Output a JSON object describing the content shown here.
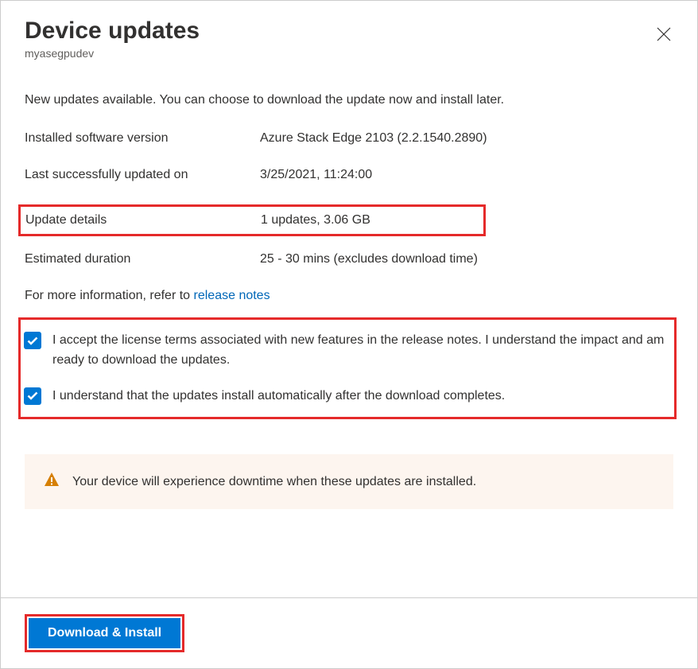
{
  "header": {
    "title": "Device updates",
    "subtitle": "myasegpudev"
  },
  "intro": "New updates available. You can choose to download the update now and install later.",
  "info": {
    "installed_version_label": "Installed software version",
    "installed_version_value": "Azure Stack Edge 2103 (2.2.1540.2890)",
    "last_updated_label": "Last successfully updated on",
    "last_updated_value": "3/25/2021, 11:24:00",
    "update_details_label": "Update details",
    "update_details_value": "1 updates, 3.06 GB",
    "duration_label": "Estimated duration",
    "duration_value": "25 - 30 mins (excludes download time)"
  },
  "more_info": {
    "prefix": "For more information, refer to ",
    "link": "release notes"
  },
  "checkboxes": {
    "accept_license": "I accept the license terms associated with new features in the release notes. I understand the impact and am ready to download the updates.",
    "auto_install": "I understand that the updates install automatically after the download completes."
  },
  "warning": "Your device will experience downtime when these updates are installed.",
  "footer": {
    "download_install": "Download & Install"
  }
}
